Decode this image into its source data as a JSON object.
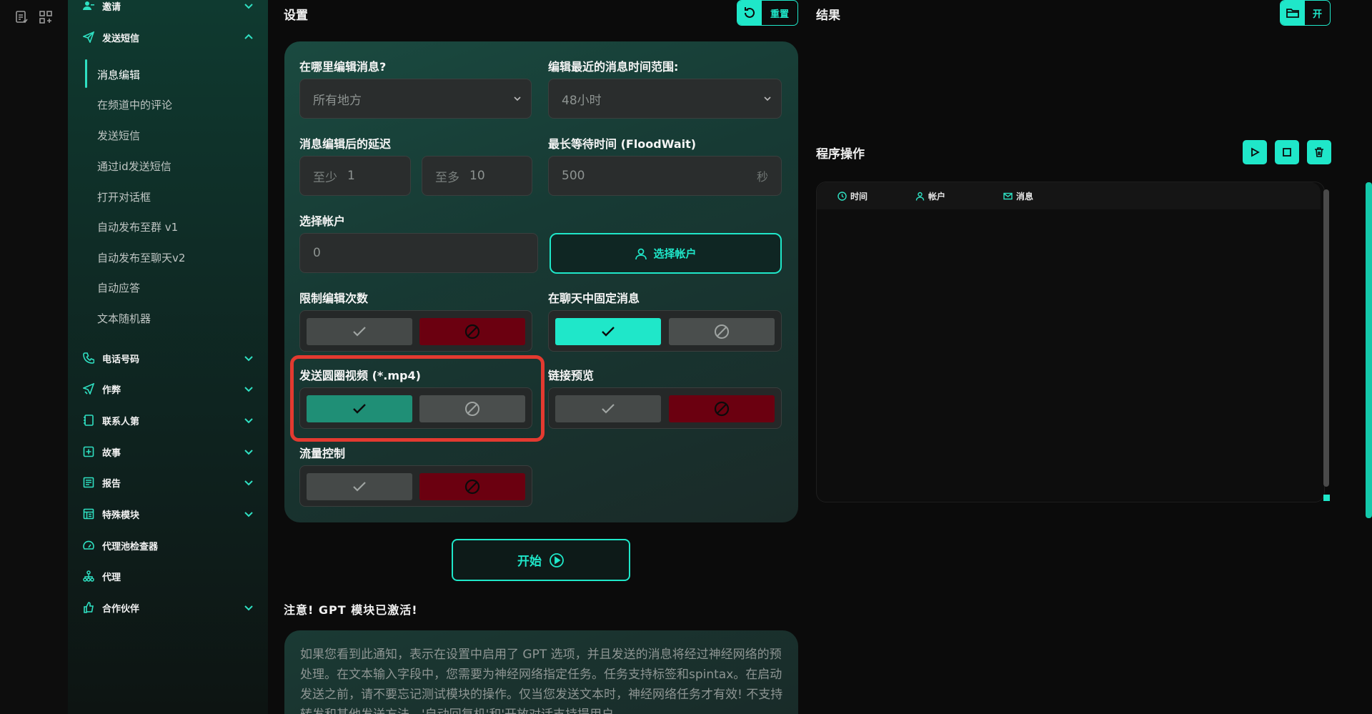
{
  "sidebar": {
    "top_items": [
      {
        "label": "邀请",
        "icon": "user-add-icon"
      },
      {
        "label": "发送短信",
        "icon": "send-icon"
      }
    ],
    "send_sms_sub": [
      "消息编辑",
      "在频道中的评论",
      "发送短信",
      "通过id发送短信",
      "打开对话框",
      "自动发布至群 v1",
      "自动发布至聊天v2",
      "自动应答",
      "文本随机器"
    ],
    "active_sub": "消息编辑",
    "groups": [
      {
        "label": "电话号码",
        "icon": "phone-icon",
        "expandable": true
      },
      {
        "label": "作弊",
        "icon": "cheat-send-icon",
        "expandable": true
      },
      {
        "label": "联系人第",
        "icon": "contacts-icon",
        "expandable": true
      },
      {
        "label": "故事",
        "icon": "story-plus-icon",
        "expandable": true
      },
      {
        "label": "报告",
        "icon": "report-icon",
        "expandable": true
      },
      {
        "label": "特殊模块",
        "icon": "special-module-icon",
        "expandable": true
      },
      {
        "label": "代理池检查器",
        "icon": "gauge-icon",
        "expandable": false
      },
      {
        "label": "代理",
        "icon": "network-icon",
        "expandable": false
      },
      {
        "label": "合作伙伴",
        "icon": "thumbs-up-icon",
        "expandable": true
      }
    ]
  },
  "settings": {
    "title": "设置",
    "reset_label": "重置",
    "where_label": "在哪里编辑消息?",
    "where_value": "所有地方",
    "range_label": "编辑最近的消息时间范围:",
    "range_value": "48小时",
    "delay_label": "消息编辑后的延迟",
    "delay_min_prefix": "至少",
    "delay_min": "1",
    "delay_max_prefix": "至多",
    "delay_max": "10",
    "floodwait_label": "最长等待时间 (FloodWait)",
    "floodwait_value": "500",
    "floodwait_unit": "秒",
    "accounts_label": "选择帐户",
    "accounts_value": "0",
    "select_accounts_button": "选择帐户",
    "limit_edits_label": "限制编辑次数",
    "pin_label": "在聊天中固定消息",
    "circle_video_label": "发送圆圈视频 (*.mp4)",
    "link_preview_label": "链接预览",
    "flow_control_label": "流量控制",
    "start_button": "开始"
  },
  "notice": {
    "title": "注意! GPT 模块已激活!",
    "text": "如果您看到此通知，表示在设置中启用了 GPT 选项，并且发送的消息将经过神经网络的预处理。在文本输入字段中，您需要为神经网络指定任务。任务支持标签和spintax。在启动发送之前，请不要忘记测试模块的操作。仅当您发送文本时，神经网络任务才有效! 不支持转发和其他发送方法。'自动回复机'和'开放对话支持提用户"
  },
  "result": {
    "title": "结果",
    "open_label": "开",
    "ops_title": "程序操作",
    "log_columns": [
      {
        "label": "时间",
        "icon": "clock-icon"
      },
      {
        "label": "帐户",
        "icon": "user-icon"
      },
      {
        "label": "消息",
        "icon": "mail-icon"
      }
    ]
  },
  "colors": {
    "accent": "#1fe7c9",
    "danger": "#6b0010",
    "highlight": "#e23a30"
  }
}
